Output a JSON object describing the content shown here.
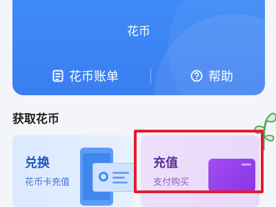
{
  "hero": {
    "title": "花币",
    "bill_label": "花币账单",
    "help_label": "帮助"
  },
  "section": {
    "title": "获取花币"
  },
  "cards": [
    {
      "title": "兑换",
      "subtitle": "花币卡充值"
    },
    {
      "title": "充值",
      "subtitle": "支付购买"
    }
  ],
  "colors": {
    "hero_blue": "#3f8af8",
    "highlight_red": "#e8192c"
  },
  "icons": {
    "bill": "bill-icon",
    "help": "help-icon"
  }
}
